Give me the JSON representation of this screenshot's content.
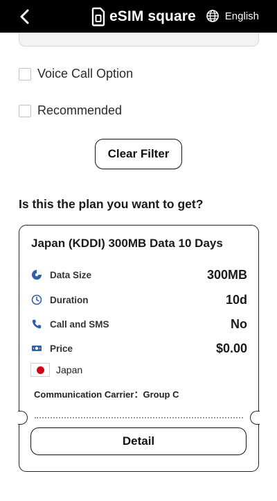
{
  "header": {
    "brand": "eSIM square",
    "language": "English",
    "icons": {
      "back": "chevron-left-icon",
      "logo": "sim-card-icon",
      "language": "globe-icon"
    }
  },
  "filters": {
    "options": [
      {
        "label": "Voice Call Option",
        "checked": false
      },
      {
        "label": "Recommended",
        "checked": false
      }
    ],
    "clear_label": "Clear Filter"
  },
  "question": "Is this the plan you want to get?",
  "plan": {
    "title": "Japan (KDDI) 300MB Data 10 Days",
    "specs": [
      {
        "label": "Data Size",
        "value": "300MB",
        "icon": "data-pie-icon"
      },
      {
        "label": "Duration",
        "value": "10d",
        "icon": "clock-icon"
      },
      {
        "label": "Call and SMS",
        "value": "No",
        "icon": "phone-icon"
      },
      {
        "label": "Price",
        "value": "$0.00",
        "icon": "banknote-icon"
      }
    ],
    "country": "Japan",
    "carrier": "Communication Carrier：Group C",
    "detail_label": "Detail"
  },
  "colors": {
    "header_bg": "#000000",
    "accent_blue": "#2f5fa8",
    "flag_red": "#d0021b"
  }
}
